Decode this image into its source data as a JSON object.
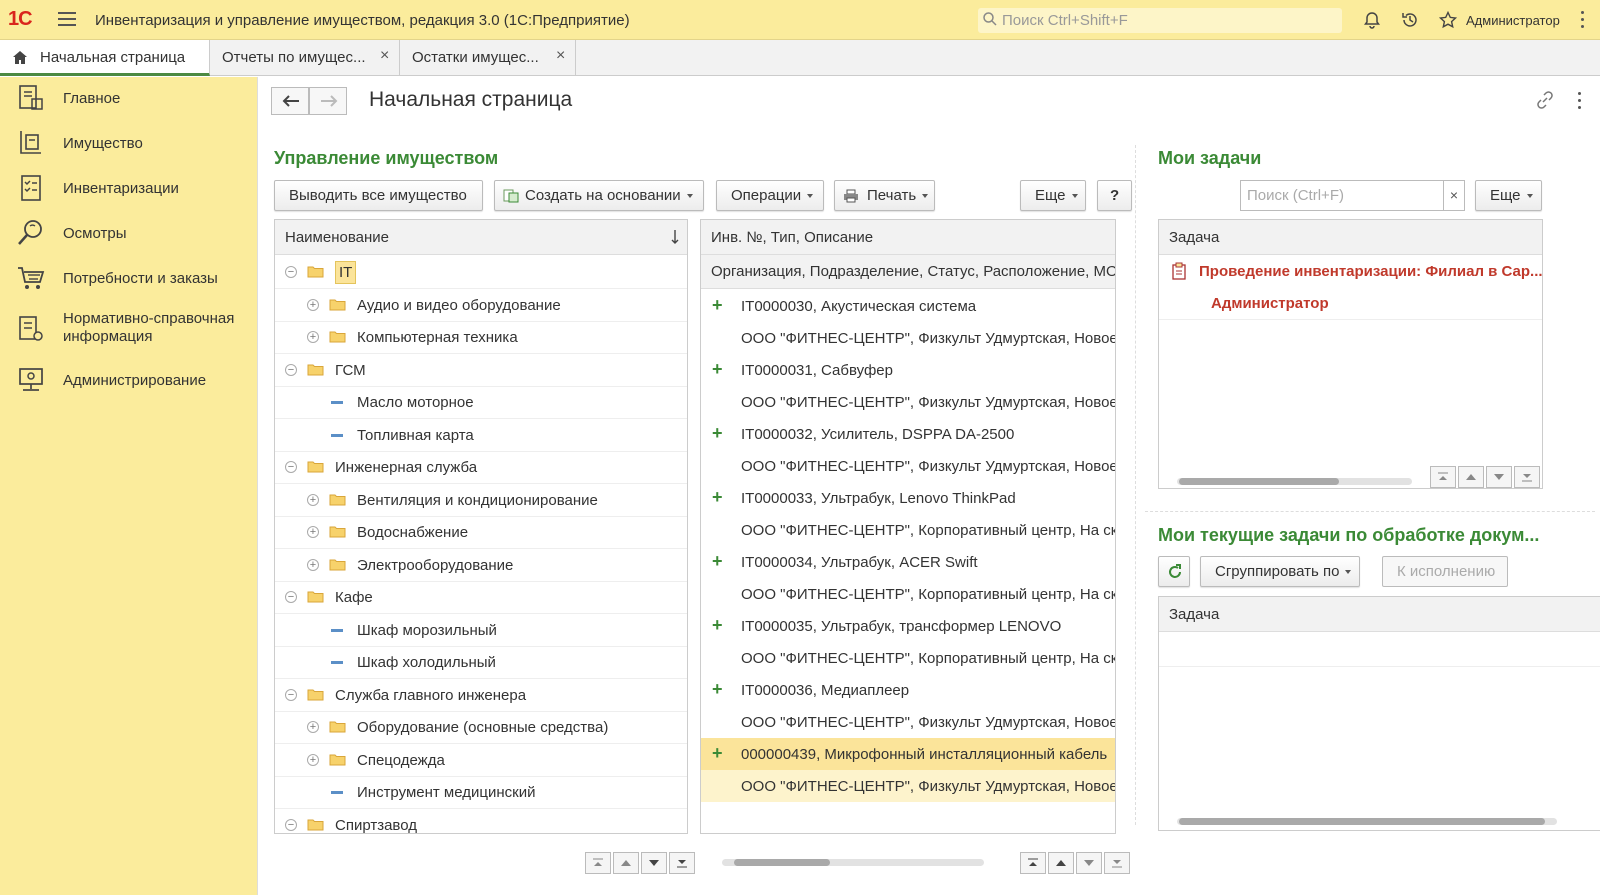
{
  "header": {
    "logo": "1С",
    "app_title": "Инвентаризация и управление имуществом, редакция 3.0  (1С:Предприятие)",
    "search_placeholder": "Поиск Ctrl+Shift+F",
    "user": "Администратор"
  },
  "tabs": [
    {
      "label": "Начальная страница",
      "active": true
    },
    {
      "label": "Отчеты по имущес..."
    },
    {
      "label": "Остатки имущес..."
    }
  ],
  "sidebar": {
    "items": [
      {
        "label": "Главное",
        "icon": "desktop-icon"
      },
      {
        "label": "Имущество",
        "icon": "property-icon"
      },
      {
        "label": "Инвентаризации",
        "icon": "checklist-icon"
      },
      {
        "label": "Осмотры",
        "icon": "magnifier-icon"
      },
      {
        "label": "Потребности и заказы",
        "icon": "cart-icon"
      },
      {
        "label": "Нормативно-справочная информация",
        "icon": "reference-icon"
      },
      {
        "label": "Администрирование",
        "icon": "admin-icon"
      }
    ]
  },
  "page": {
    "title": "Начальная страница"
  },
  "property_management": {
    "title": "Управление имуществом",
    "buttons": {
      "show_all": "Выводить все имущество",
      "create_based": "Создать на основании",
      "operations": "Операции",
      "print": "Печать",
      "more": "Еще",
      "help": "?"
    },
    "tree_header": "Наименование",
    "tree_rows": [
      {
        "label": "IT",
        "level": 0,
        "type": "folder",
        "expanded": true,
        "selected": true
      },
      {
        "label": "Аудио и видео оборудование",
        "level": 1,
        "type": "folder",
        "expanded": false
      },
      {
        "label": "Компьютерная техника",
        "level": 1,
        "type": "folder",
        "expanded": false
      },
      {
        "label": "ГСМ",
        "level": 0,
        "type": "folder",
        "expanded": true
      },
      {
        "label": "Масло моторное",
        "level": 1,
        "type": "item"
      },
      {
        "label": "Топливная карта",
        "level": 1,
        "type": "item"
      },
      {
        "label": "Инженерная служба",
        "level": 0,
        "type": "folder",
        "expanded": true
      },
      {
        "label": "Вентиляция и кондиционирование",
        "level": 1,
        "type": "folder",
        "expanded": false
      },
      {
        "label": "Водоснабжение",
        "level": 1,
        "type": "folder",
        "expanded": false
      },
      {
        "label": "Электрооборудование",
        "level": 1,
        "type": "folder",
        "expanded": false
      },
      {
        "label": "Кафе",
        "level": 0,
        "type": "folder",
        "expanded": true
      },
      {
        "label": "Шкаф морозильный",
        "level": 1,
        "type": "item"
      },
      {
        "label": "Шкаф холодильный",
        "level": 1,
        "type": "item"
      },
      {
        "label": "Служба главного инженера",
        "level": 0,
        "type": "folder",
        "expanded": true
      },
      {
        "label": "Оборудование (основные средства)",
        "level": 1,
        "type": "folder",
        "expanded": false
      },
      {
        "label": "Спецодежда",
        "level": 1,
        "type": "folder",
        "expanded": false
      },
      {
        "label": "Инструмент медицинский",
        "level": 1,
        "type": "item"
      },
      {
        "label": "Спиртзавод",
        "level": 0,
        "type": "folder",
        "expanded": true
      }
    ],
    "list_header_1": "Инв. №, Тип, Описание",
    "list_header_2": "Организация, Подразделение, Статус, Расположение, МОЛ",
    "list_rows": [
      {
        "plus": "+",
        "label": "IT0000030, Акустическая система"
      },
      {
        "plus": "",
        "label": "ООО \"ФИТНЕС-ЦЕНТР\", Физкульт Удмуртская, Новое"
      },
      {
        "plus": "+",
        "label": "IT0000031, Сабвуфер"
      },
      {
        "plus": "",
        "label": "ООО \"ФИТНЕС-ЦЕНТР\", Физкульт Удмуртская, Новое"
      },
      {
        "plus": "+",
        "label": "IT0000032, Усилитель, DSPPA DA-2500"
      },
      {
        "plus": "",
        "label": "ООО \"ФИТНЕС-ЦЕНТР\", Физкульт Удмуртская, Новое"
      },
      {
        "plus": "+",
        "label": "IT0000033, Ультрабук, Lenovo ThinkPad"
      },
      {
        "plus": "",
        "label": "ООО \"ФИТНЕС-ЦЕНТР\", Корпоративный центр, На ск"
      },
      {
        "plus": "+",
        "label": "IT0000034, Ультрабук, ACER Swift"
      },
      {
        "plus": "",
        "label": "ООО \"ФИТНЕС-ЦЕНТР\", Корпоративный центр, На ск"
      },
      {
        "plus": "+",
        "label": "IT0000035, Ультрабук, трансформер LENOVO"
      },
      {
        "plus": "",
        "label": "ООО \"ФИТНЕС-ЦЕНТР\", Корпоративный центр, На ск"
      },
      {
        "plus": "+",
        "label": "IT0000036, Медиаплеер"
      },
      {
        "plus": "",
        "label": "ООО \"ФИТНЕС-ЦЕНТР\", Физкульт Удмуртская, Новое"
      },
      {
        "plus": "+",
        "label": "000000439, Микрофонный инсталляционный кабель",
        "selected": true
      },
      {
        "plus": "",
        "label": "ООО \"ФИТНЕС-ЦЕНТР\", Физкульт Удмуртская, Новое",
        "selected": true
      }
    ]
  },
  "my_tasks": {
    "title": "Мои задачи",
    "search_placeholder": "Поиск (Ctrl+F)",
    "clear": "×",
    "more": "Еще",
    "header": "Задача",
    "task_title": "Проведение инвентаризации: Филиал в Сар...",
    "task_author": "Администратор"
  },
  "current_tasks": {
    "title": "Мои текущие задачи по обработке докум...",
    "group_by": "Сгруппировать по",
    "execute": "К исполнению",
    "header": "Задача"
  },
  "colors": {
    "accent_green": "#3b8a36",
    "sidebar_yellow": "#fbec9c",
    "task_red": "#c0392b",
    "selection": "#fbe49a"
  }
}
